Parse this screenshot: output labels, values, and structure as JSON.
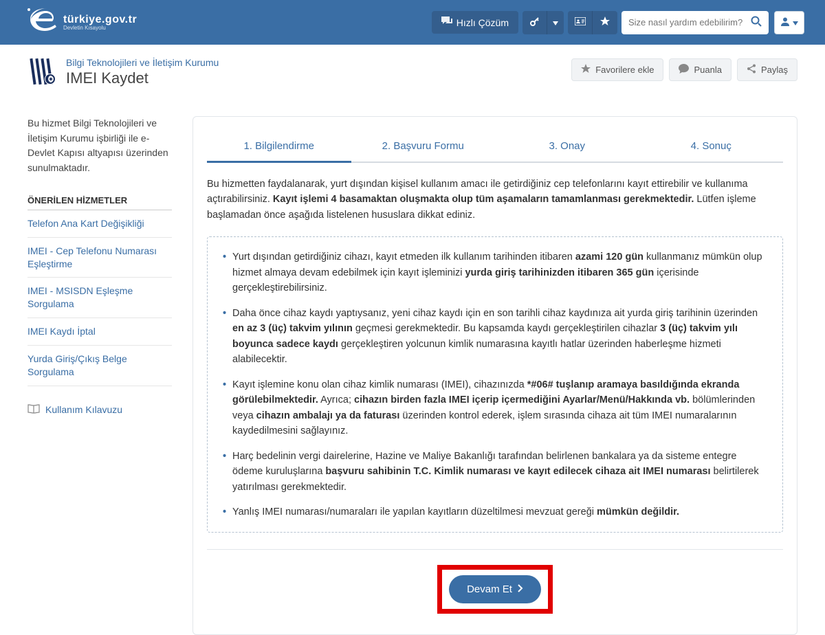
{
  "header": {
    "logo_text": "türkiye.gov.tr",
    "logo_sub": "Devletin Kısayolu",
    "quick_solution": "Hızlı Çözüm",
    "search_placeholder": "Size nasıl yardım edebilirim?"
  },
  "page_head": {
    "institution": "Bilgi Teknolojileri ve İletişim Kurumu",
    "title": "IMEI Kaydet",
    "fav": "Favorilere ekle",
    "rate": "Puanla",
    "share": "Paylaş"
  },
  "sidebar": {
    "desc": "Bu hizmet Bilgi Teknolojileri ve İletişim Kurumu işbirliği ile e-Devlet Kapısı altyapısı üzerinden sunulmaktadır.",
    "heading": "ÖNERİLEN HİZMETLER",
    "links": [
      "Telefon Ana Kart Değişikliği",
      "IMEI - Cep Telefonu Numarası Eşleştirme",
      "IMEI - MSISDN Eşleşme Sorgulama",
      "IMEI Kaydı İptal",
      "Yurda Giriş/Çıkış Belge Sorgulama"
    ],
    "guide": "Kullanım Kılavuzu"
  },
  "steps": [
    "1. Bilgilendirme",
    "2. Başvuru Formu",
    "3. Onay",
    "4. Sonuç"
  ],
  "intro": {
    "p1": "Bu hizmetten faydalanarak, yurt dışından kişisel kullanım amacı ile getirdiğiniz cep telefonlarını kayıt ettirebilir ve kullanıma açtırabilirsiniz. ",
    "p1_bold": "Kayıt işlemi 4 basamaktan oluşmakta olup tüm aşamaların tamamlanması gerekmektedir.",
    "p1_tail": " Lütfen işleme başlamadan önce aşağıda listelenen hususlara dikkat ediniz."
  },
  "bullets": {
    "b1_a": "Yurt dışından getirdiğiniz cihazı, kayıt etmeden ilk kullanım tarihinden itibaren ",
    "b1_bold1": "azami 120 gün",
    "b1_b": " kullanmanız mümkün olup hizmet almaya devam edebilmek için kayıt işleminizi ",
    "b1_bold2": "yurda giriş tarihinizden itibaren 365 gün",
    "b1_c": " içerisinde gerçekleştirebilirsiniz.",
    "b2_a": "Daha önce cihaz kaydı yaptıysanız, yeni cihaz kaydı için en son tarihli cihaz kaydınıza ait yurda giriş tarihinin üzerinden ",
    "b2_bold1": "en az 3 (üç) takvim yılının",
    "b2_b": " geçmesi gerekmektedir. Bu kapsamda kaydı gerçekleştirilen cihazlar ",
    "b2_bold2": "3 (üç) takvim yılı boyunca sadece kaydı",
    "b2_c": " gerçekleştiren yolcunun kimlik numarasına kayıtlı hatlar üzerinden haberleşme hizmeti alabilecektir.",
    "b3_a": "Kayıt işlemine konu olan cihaz kimlik numarası (IMEI), cihazınızda ",
    "b3_bold1": "*#06# tuşlanıp aramaya basıldığında ekranda görülebilmektedir.",
    "b3_b": " Ayrıca; ",
    "b3_bold2": "cihazın birden fazla IMEI içerip içermediğini Ayarlar/Menü/Hakkında vb.",
    "b3_c": " bölümlerinden veya ",
    "b3_bold3": "cihazın ambalajı ya da faturası",
    "b3_d": " üzerinden kontrol ederek, işlem sırasında cihaza ait tüm IMEI numaralarının kaydedilmesini sağlayınız.",
    "b4_a": "Harç bedelinin vergi dairelerine, Hazine ve Maliye Bakanlığı tarafından belirlenen bankalara ya da sisteme entegre ödeme kuruluşlarına ",
    "b4_bold1": "başvuru sahibinin T.C. Kimlik numarası ve kayıt edilecek cihaza ait IMEI numarası",
    "b4_b": " belirtilerek yatırılması gerekmektedir.",
    "b5_a": "Yanlış IMEI numarası/numaraları ile yapılan kayıtların düzeltilmesi mevzuat gereği ",
    "b5_bold1": "mümkün değildir."
  },
  "continue_label": "Devam Et"
}
